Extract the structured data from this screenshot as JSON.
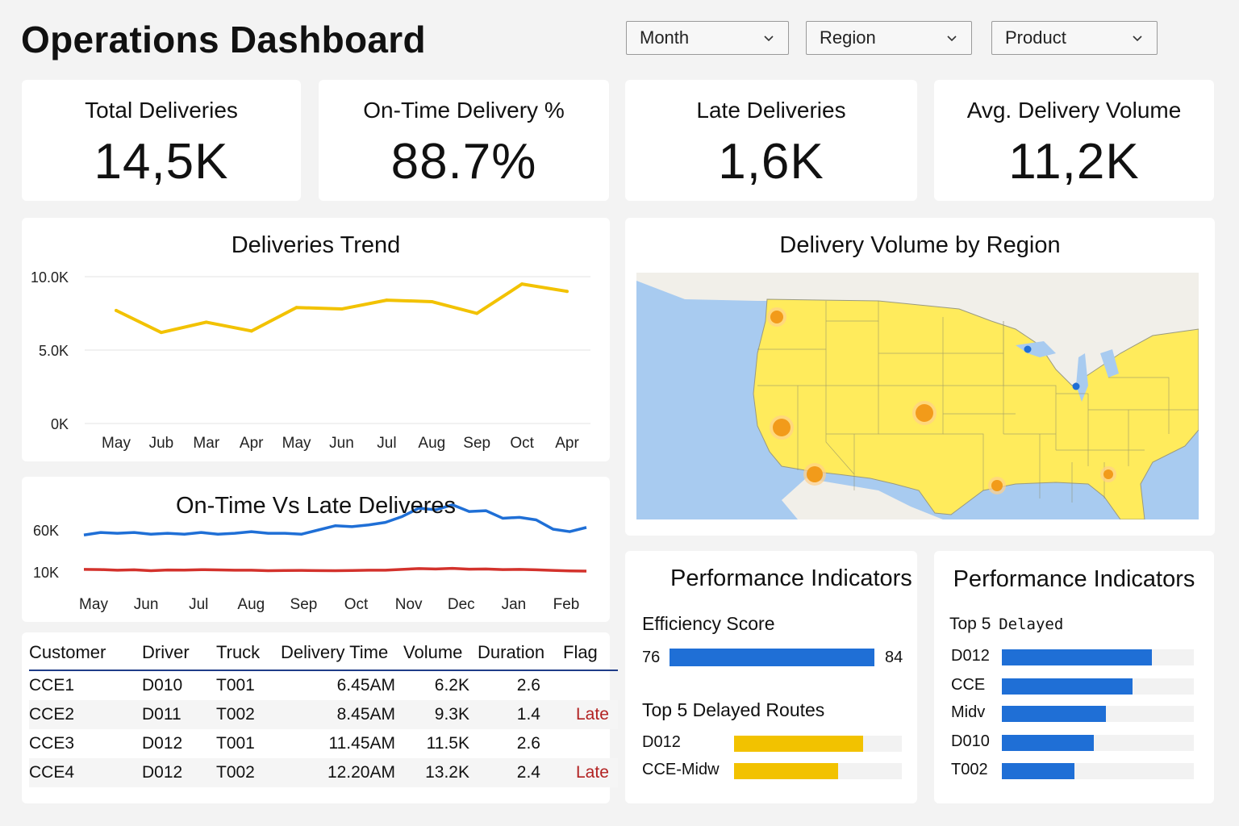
{
  "header": {
    "title": "Operations Dashboard",
    "filters": [
      {
        "label": "Month"
      },
      {
        "label": "Region"
      },
      {
        "label": "Product"
      }
    ]
  },
  "kpis": [
    {
      "label": "Total Deliveries",
      "value": "14,5K"
    },
    {
      "label": "On-Time Delivery %",
      "value": "88.7%"
    },
    {
      "label": "Late Deliveries",
      "value": "1,6K"
    },
    {
      "label": "Avg. Delivery Volume",
      "value": "11,2K"
    }
  ],
  "trend": {
    "title": "Deliveries Trend",
    "color": "#f2c200",
    "chart_data": {
      "type": "line",
      "categories": [
        "May",
        "Jub",
        "Mar",
        "Apr",
        "May",
        "Jun",
        "Jul",
        "Aug",
        "Sep",
        "Oct",
        "Apr"
      ],
      "yticks": [
        "10.0K",
        "5.0K",
        "0K"
      ],
      "ylim": [
        0,
        10000
      ],
      "series": [
        {
          "values": [
            7700,
            6200,
            6900,
            6300,
            7900,
            7800,
            8400,
            8300,
            7500,
            9500,
            9000
          ]
        }
      ]
    }
  },
  "ontime": {
    "title": "On-Time Vs Late Deliveres",
    "chart_data": {
      "type": "line",
      "categories": [
        "May",
        "Jun",
        "Jul",
        "Aug",
        "Sep",
        "Oct",
        "Nov",
        "Dec",
        "Jan",
        "Feb"
      ],
      "yticks": [
        "60K",
        "10K"
      ],
      "series": [
        {
          "color": "#1f6fd6",
          "values": [
            54000,
            57000,
            56000,
            57000,
            55000,
            56000,
            55000,
            57000,
            55000,
            56000,
            58000,
            56000,
            56000,
            55000,
            60000,
            65000,
            64000,
            66000,
            69000,
            76000,
            86000,
            84000,
            90000,
            82000,
            83000,
            74000,
            75000,
            72000,
            61000,
            58000,
            63000
          ]
        },
        {
          "color": "#d3322c",
          "values": [
            13000,
            12800,
            12000,
            12500,
            11500,
            12300,
            12200,
            12700,
            12400,
            12100,
            12000,
            11500,
            11700,
            11800,
            11600,
            11500,
            11700,
            12000,
            12100,
            13000,
            14000,
            13500,
            14200,
            13200,
            13500,
            12800,
            13000,
            12500,
            11800,
            11200,
            11000
          ]
        }
      ]
    }
  },
  "map": {
    "title": "Delivery Volume by Region",
    "land_color": "#ffeb5c",
    "water_color": "#a8cbf0",
    "markers_orange": 7,
    "markers_blue": 2
  },
  "table": {
    "columns": [
      "Customer",
      "Driver",
      "Truck",
      "Delivery Time",
      "Volume",
      "Duration",
      "Flag"
    ],
    "rows": [
      [
        "CCE1",
        "D010",
        "T001",
        "6.45AM",
        "6.2K",
        "2.6",
        ""
      ],
      [
        "CCE2",
        "D011",
        "T002",
        "8.45AM",
        "9.3K",
        "1.4",
        "Late"
      ],
      [
        "CCE3",
        "D012",
        "T001",
        "11.45AM",
        "11.5K",
        "2.6",
        ""
      ],
      [
        "CCE4",
        "D012",
        "T002",
        "12.20AM",
        "13.2K",
        "2.4",
        "Late"
      ]
    ]
  },
  "perf1": {
    "title": "Performance Indicators",
    "efficiency": {
      "label": "Efficiency Score",
      "min": "76",
      "max": "84",
      "fraction": 1.0,
      "color": "#1f6fd6"
    },
    "routes_label": "Top 5 Delayed Routes",
    "routes": [
      {
        "name": "D012",
        "fraction": 0.77,
        "color": "#f2c200"
      },
      {
        "name": "CCE-Midw",
        "fraction": 0.62,
        "color": "#f2c200"
      }
    ]
  },
  "perf2": {
    "title": "Performance Indicators",
    "subtitle_a": "Top 5",
    "subtitle_b": "Delayed",
    "bars": [
      {
        "name": "D012",
        "fraction": 0.78,
        "color": "#1f6fd6"
      },
      {
        "name": "CCE",
        "fraction": 0.68,
        "color": "#1f6fd6"
      },
      {
        "name": "Midv",
        "fraction": 0.54,
        "color": "#1f6fd6"
      },
      {
        "name": "D010",
        "fraction": 0.48,
        "color": "#1f6fd6"
      },
      {
        "name": "T002",
        "fraction": 0.38,
        "color": "#1f6fd6"
      }
    ]
  }
}
